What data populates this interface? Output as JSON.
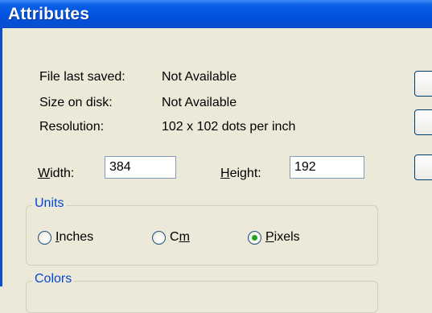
{
  "window": {
    "title": "Attributes"
  },
  "info": {
    "file_last_saved_label": "File last saved:",
    "file_last_saved_value": "Not Available",
    "size_on_disk_label": "Size on disk:",
    "size_on_disk_value": "Not Available",
    "resolution_label": "Resolution:",
    "resolution_value": "102 x 102 dots per inch"
  },
  "dimensions": {
    "width_label_u": "W",
    "width_label_rest": "idth:",
    "width_value": "384",
    "height_label_u": "H",
    "height_label_rest": "eight:",
    "height_value": "192"
  },
  "units": {
    "title": "Units",
    "inches_u": "I",
    "inches_rest": "nches",
    "cm_pre": "C",
    "cm_u": "m",
    "pixels_u": "P",
    "pixels_rest": "ixels",
    "selected": "Pixels"
  },
  "colors": {
    "title": "Colors"
  }
}
